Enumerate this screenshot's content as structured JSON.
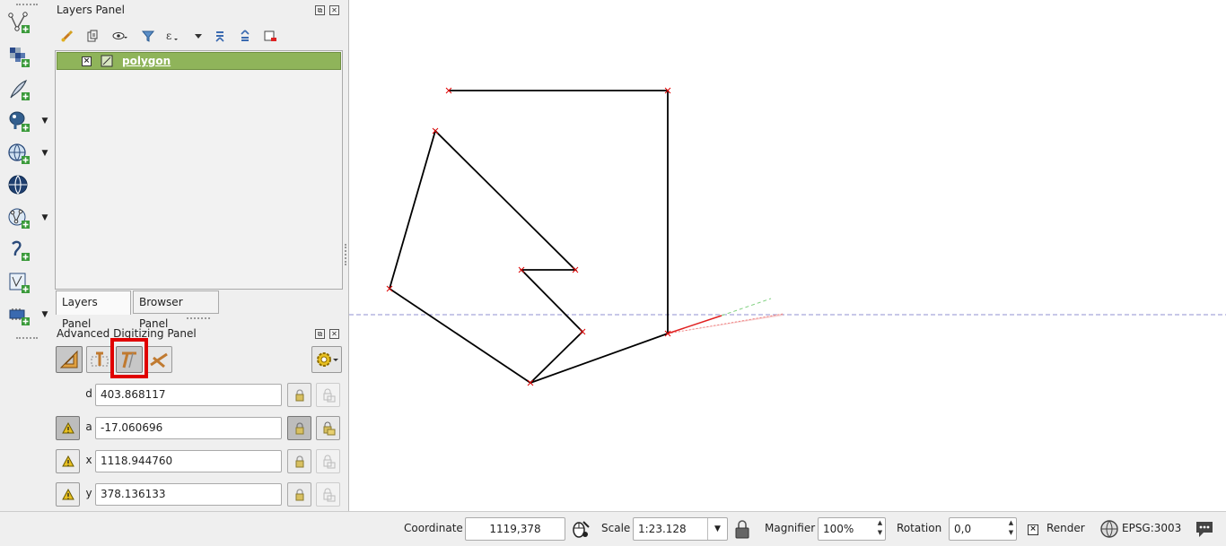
{
  "layers_panel": {
    "title": "Layers Panel",
    "layer": {
      "name": "polygon",
      "checked": true
    },
    "tabs": [
      "Layers Panel",
      "Browser Panel"
    ],
    "active_tab": "Layers Panel"
  },
  "advanced_digitizing": {
    "title": "Advanced Digitizing Panel",
    "fields": [
      {
        "label": "d",
        "value": "403.868117",
        "constraint_on": false,
        "lock_on": false
      },
      {
        "label": "a",
        "value": "-17.060696",
        "constraint_on": true,
        "lock_on": true
      },
      {
        "label": "x",
        "value": "1118.944760",
        "constraint_on": false,
        "lock_on": false
      },
      {
        "label": "y",
        "value": "378.136133",
        "constraint_on": false,
        "lock_on": false
      }
    ]
  },
  "status_bar": {
    "coordinate_label": "Coordinate",
    "coordinate_value": "1119,378",
    "scale_label": "Scale",
    "scale_value": "1:23.128",
    "magnifier_label": "Magnifier",
    "magnifier_value": "100%",
    "rotation_label": "Rotation",
    "rotation_value": "0,0",
    "render_label": "Render",
    "render_checked": true,
    "crs_label": "EPSG:3003"
  },
  "colors": {
    "layer_selected_bg": "#8fb45a",
    "highlight_box": "#e00000",
    "polygon_stroke": "#000000",
    "vertex_marker": "#e00000",
    "guide_line": "#9090d0"
  }
}
